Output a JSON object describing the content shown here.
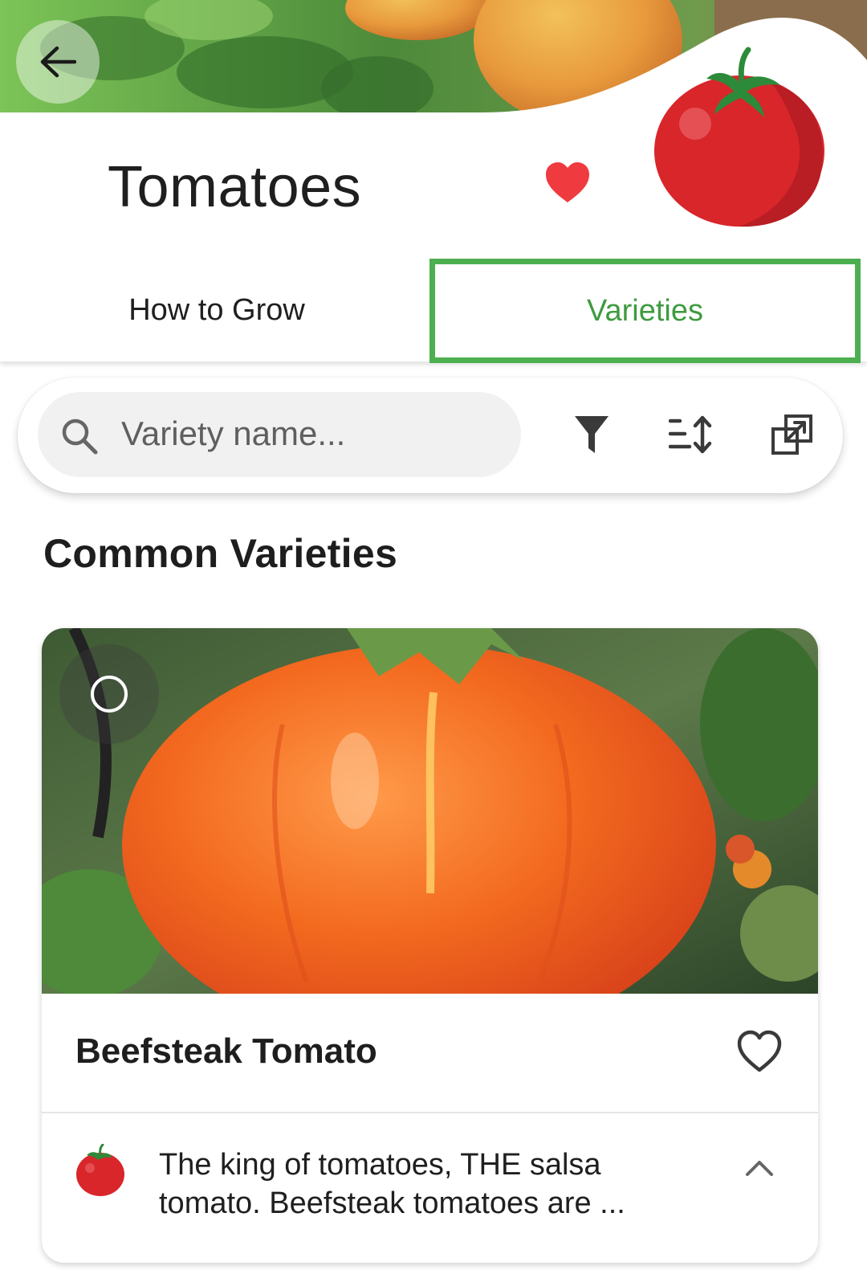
{
  "header": {
    "title": "Tomatoes",
    "back_icon": "arrow-left-icon",
    "favorite_icon": "heart-filled-icon",
    "favorite_color": "#ef3b3f",
    "logo_icon": "tomato-icon"
  },
  "tabs": [
    {
      "label": "How to Grow",
      "selected": false
    },
    {
      "label": "Varieties",
      "selected": true
    }
  ],
  "accent_color": "#4caf50",
  "search": {
    "placeholder": "Variety name...",
    "value": "",
    "icons": [
      "search-icon",
      "filter-icon",
      "sort-icon",
      "open-in-new-icon"
    ]
  },
  "section_title": "Common Varieties",
  "varieties": [
    {
      "name": "Beefsteak Tomato",
      "description": "The king of tomatoes, THE salsa tomato. Beefsteak tomatoes are ...",
      "favorite": false,
      "selected": false,
      "expand_icon": "chevron-up-icon"
    }
  ]
}
